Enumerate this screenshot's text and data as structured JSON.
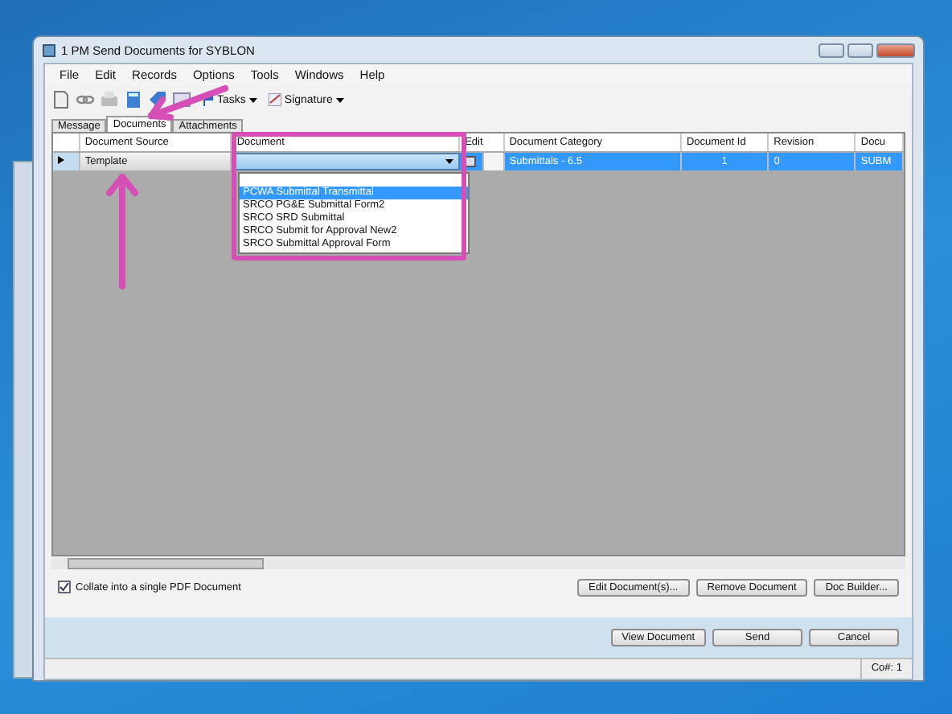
{
  "window": {
    "title": "1 PM Send Documents for SYBLON"
  },
  "menu": [
    "File",
    "Edit",
    "Records",
    "Options",
    "Tools",
    "Windows",
    "Help"
  ],
  "toolbar": {
    "dropdowns": [
      "Tasks",
      "Signature"
    ]
  },
  "tabs": [
    {
      "label": "Message",
      "selected": false
    },
    {
      "label": "Documents",
      "selected": true
    },
    {
      "label": "Attachments",
      "selected": false
    }
  ],
  "grid": {
    "columns": [
      "Document Source",
      "Document",
      "Edit",
      "Document Category",
      "Document Id",
      "Revision",
      "Docu"
    ],
    "rows": [
      {
        "selected": true,
        "source": "Template",
        "document": "",
        "edit_checked": false,
        "category": "Submittals - 6.5",
        "document_id": "1",
        "revision": "0",
        "column_7": "SUBM"
      }
    ],
    "dropdown_options": [
      {
        "label": "PCWA Submittal Transmittal",
        "selected": true
      },
      {
        "label": "SRCO PG&E Submittal Form2",
        "selected": false
      },
      {
        "label": "SRCO SRD Submittal",
        "selected": false
      },
      {
        "label": "SRCO Submit for Approval New2",
        "selected": false
      },
      {
        "label": "SRCO Submittal Approval Form",
        "selected": false
      }
    ]
  },
  "collate": {
    "label": "Collate into a single PDF Document",
    "checked": true
  },
  "grid_buttons": [
    "Edit Document(s)...",
    "Remove Document",
    "Doc Builder..."
  ],
  "dialog_buttons": [
    "View Document",
    "Send",
    "Cancel"
  ],
  "status_bar": {
    "text": "Co#: 1"
  }
}
